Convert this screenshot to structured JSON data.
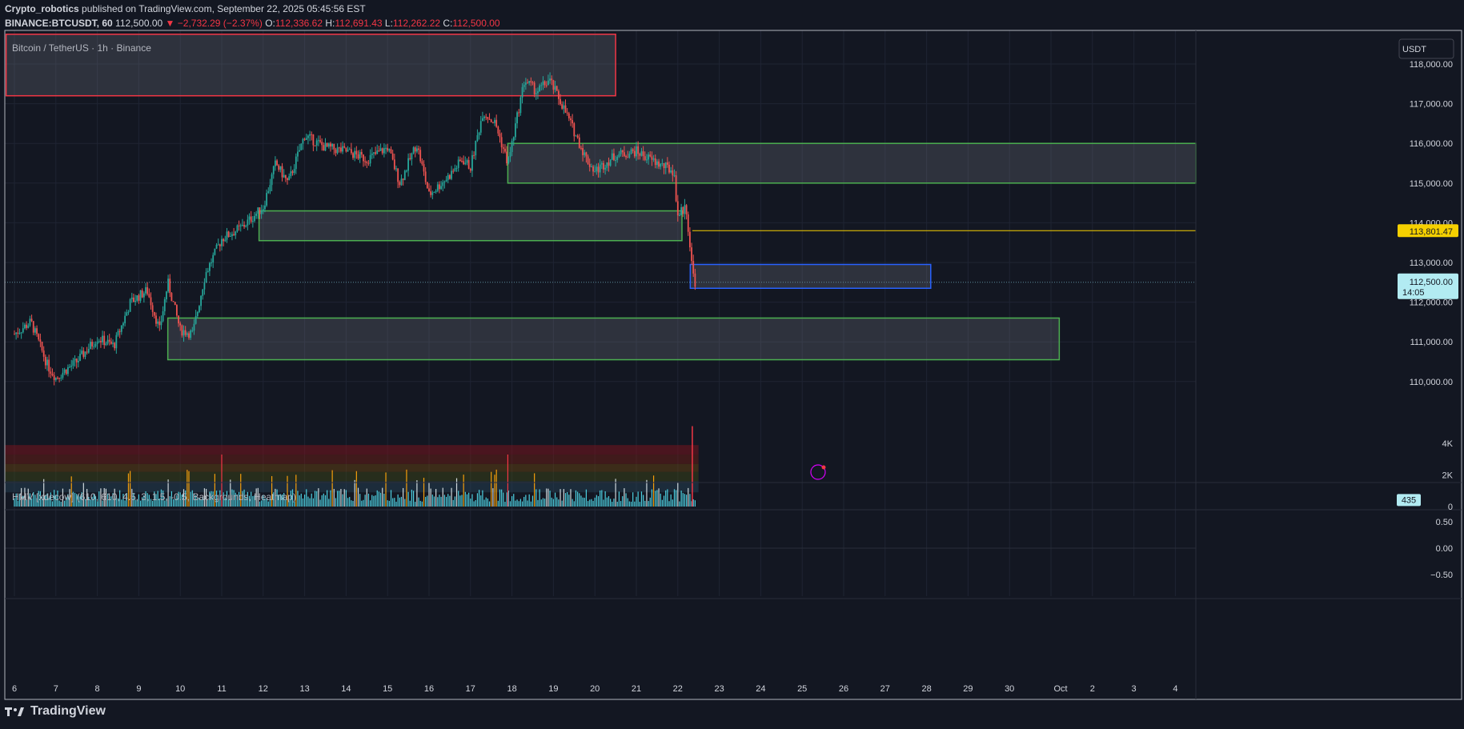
{
  "header": {
    "author": "Crypto_robotics",
    "published_text": "published on TradingView.com, September 22, 2025 05:45:56 EST",
    "symbol": "BINANCE:BTCUSDT, 60",
    "last_price": "112,500.00",
    "change": "▼ −2,732.29 (−2.37%)",
    "o_label": "O:",
    "o_value": "112,336.62",
    "h_label": "H:",
    "h_value": "112,691.43",
    "l_label": "L:",
    "l_value": "112,262.22",
    "c_label": "C:",
    "c_value": "112,500.00"
  },
  "chart_title": "Bitcoin / TetherUS · 1h · Binance",
  "currency_button": "USDT",
  "indicator_title": "HMV [xdecow] (610, 610, 4.5, 3, 1.5, -0.5, Backgrounds, Heatmap)",
  "price_axis": {
    "ticks": [
      "118,000.00",
      "117,000.00",
      "116,000.00",
      "115,000.00",
      "114,000.00",
      "113,000.00",
      "112,000.00",
      "111,000.00",
      "110,000.00"
    ],
    "highlight_level": "113,801.47",
    "current_price": "112,500.00",
    "countdown": "14:05"
  },
  "volume_axis": {
    "ticks": [
      "4K",
      "2K",
      "0"
    ],
    "current": "435"
  },
  "osc_axis": {
    "ticks": [
      "0.50",
      "0.00",
      "−0.50"
    ]
  },
  "time_axis": {
    "ticks": [
      "6",
      "7",
      "8",
      "9",
      "10",
      "11",
      "12",
      "13",
      "14",
      "15",
      "16",
      "17",
      "18",
      "19",
      "20",
      "21",
      "22",
      "23",
      "24",
      "25",
      "26",
      "27",
      "28",
      "29",
      "30",
      "Oct",
      "2",
      "3",
      "4"
    ]
  },
  "footer": {
    "logo_text": "TradingView"
  },
  "colors": {
    "background": "#131722",
    "up": "#26a69a",
    "down": "#ef5350",
    "zone_green": "#4caf50",
    "zone_red": "#f23645",
    "zone_blue": "#2962ff",
    "level_yellow": "#f5d000",
    "grid": "#1f2433"
  },
  "chart_data": {
    "type": "candlestick",
    "title": "Bitcoin / TetherUS · 1h · Binance",
    "x_axis": {
      "labels": [
        "6",
        "7",
        "8",
        "9",
        "10",
        "11",
        "12",
        "13",
        "14",
        "15",
        "16",
        "17",
        "18",
        "19",
        "20",
        "21",
        "22",
        "23",
        "24",
        "25",
        "26",
        "27",
        "28",
        "29",
        "30",
        "Oct",
        "2",
        "3",
        "4"
      ],
      "unit": "day (Sep–Oct 2025)"
    },
    "y_axis": {
      "range": [
        109300,
        118750
      ],
      "unit": "USDT"
    },
    "close_path": [
      {
        "day": 6.0,
        "price": 111200
      },
      {
        "day": 6.4,
        "price": 111500
      },
      {
        "day": 6.8,
        "price": 110400
      },
      {
        "day": 7.0,
        "price": 110100
      },
      {
        "day": 7.5,
        "price": 110500
      },
      {
        "day": 8.0,
        "price": 111100
      },
      {
        "day": 8.4,
        "price": 110900
      },
      {
        "day": 8.8,
        "price": 112000
      },
      {
        "day": 9.2,
        "price": 112300
      },
      {
        "day": 9.5,
        "price": 111300
      },
      {
        "day": 9.7,
        "price": 112500
      },
      {
        "day": 10.0,
        "price": 111300
      },
      {
        "day": 10.3,
        "price": 111200
      },
      {
        "day": 10.6,
        "price": 112700
      },
      {
        "day": 11.0,
        "price": 113600
      },
      {
        "day": 11.5,
        "price": 113900
      },
      {
        "day": 12.0,
        "price": 114400
      },
      {
        "day": 12.3,
        "price": 115500
      },
      {
        "day": 12.6,
        "price": 115000
      },
      {
        "day": 13.0,
        "price": 116200
      },
      {
        "day": 13.5,
        "price": 115900
      },
      {
        "day": 14.0,
        "price": 115800
      },
      {
        "day": 14.5,
        "price": 115600
      },
      {
        "day": 15.0,
        "price": 115900
      },
      {
        "day": 15.3,
        "price": 115000
      },
      {
        "day": 15.7,
        "price": 116000
      },
      {
        "day": 16.0,
        "price": 114700
      },
      {
        "day": 16.5,
        "price": 115200
      },
      {
        "day": 16.8,
        "price": 115600
      },
      {
        "day": 17.0,
        "price": 115400
      },
      {
        "day": 17.3,
        "price": 116800
      },
      {
        "day": 17.6,
        "price": 116500
      },
      {
        "day": 17.9,
        "price": 115500
      },
      {
        "day": 18.0,
        "price": 116000
      },
      {
        "day": 18.3,
        "price": 117600
      },
      {
        "day": 18.6,
        "price": 117300
      },
      {
        "day": 18.9,
        "price": 117600
      },
      {
        "day": 19.2,
        "price": 117000
      },
      {
        "day": 19.5,
        "price": 116300
      },
      {
        "day": 19.8,
        "price": 115600
      },
      {
        "day": 20.0,
        "price": 115300
      },
      {
        "day": 20.5,
        "price": 115700
      },
      {
        "day": 21.0,
        "price": 115800
      },
      {
        "day": 21.5,
        "price": 115500
      },
      {
        "day": 21.9,
        "price": 115300
      },
      {
        "day": 22.0,
        "price": 114200
      },
      {
        "day": 22.2,
        "price": 114400
      },
      {
        "day": 22.35,
        "price": 112800
      },
      {
        "day": 22.42,
        "price": 112500
      }
    ],
    "levels": [
      {
        "name": "Highlighted level",
        "price": 113801.47
      }
    ],
    "zones": [
      {
        "color": "red",
        "from_day": 5.8,
        "to_day": 20.5,
        "low": 117200,
        "high": 118750
      },
      {
        "color": "green",
        "from_day": 17.9,
        "to_day": 34.5,
        "low": 115000,
        "high": 116000
      },
      {
        "color": "green",
        "from_day": 11.9,
        "to_day": 22.1,
        "low": 113550,
        "high": 114300
      },
      {
        "color": "blue",
        "from_day": 22.3,
        "to_day": 28.1,
        "low": 112350,
        "high": 112950
      },
      {
        "color": "green",
        "from_day": 9.7,
        "to_day": 31.2,
        "low": 110550,
        "high": 111600
      }
    ],
    "volume": {
      "range": [
        0,
        5000
      ],
      "current": 435,
      "spike_day": 22.35,
      "spike_value": 5100
    },
    "oscillator": {
      "range": [
        -0.6,
        0.6
      ]
    }
  }
}
